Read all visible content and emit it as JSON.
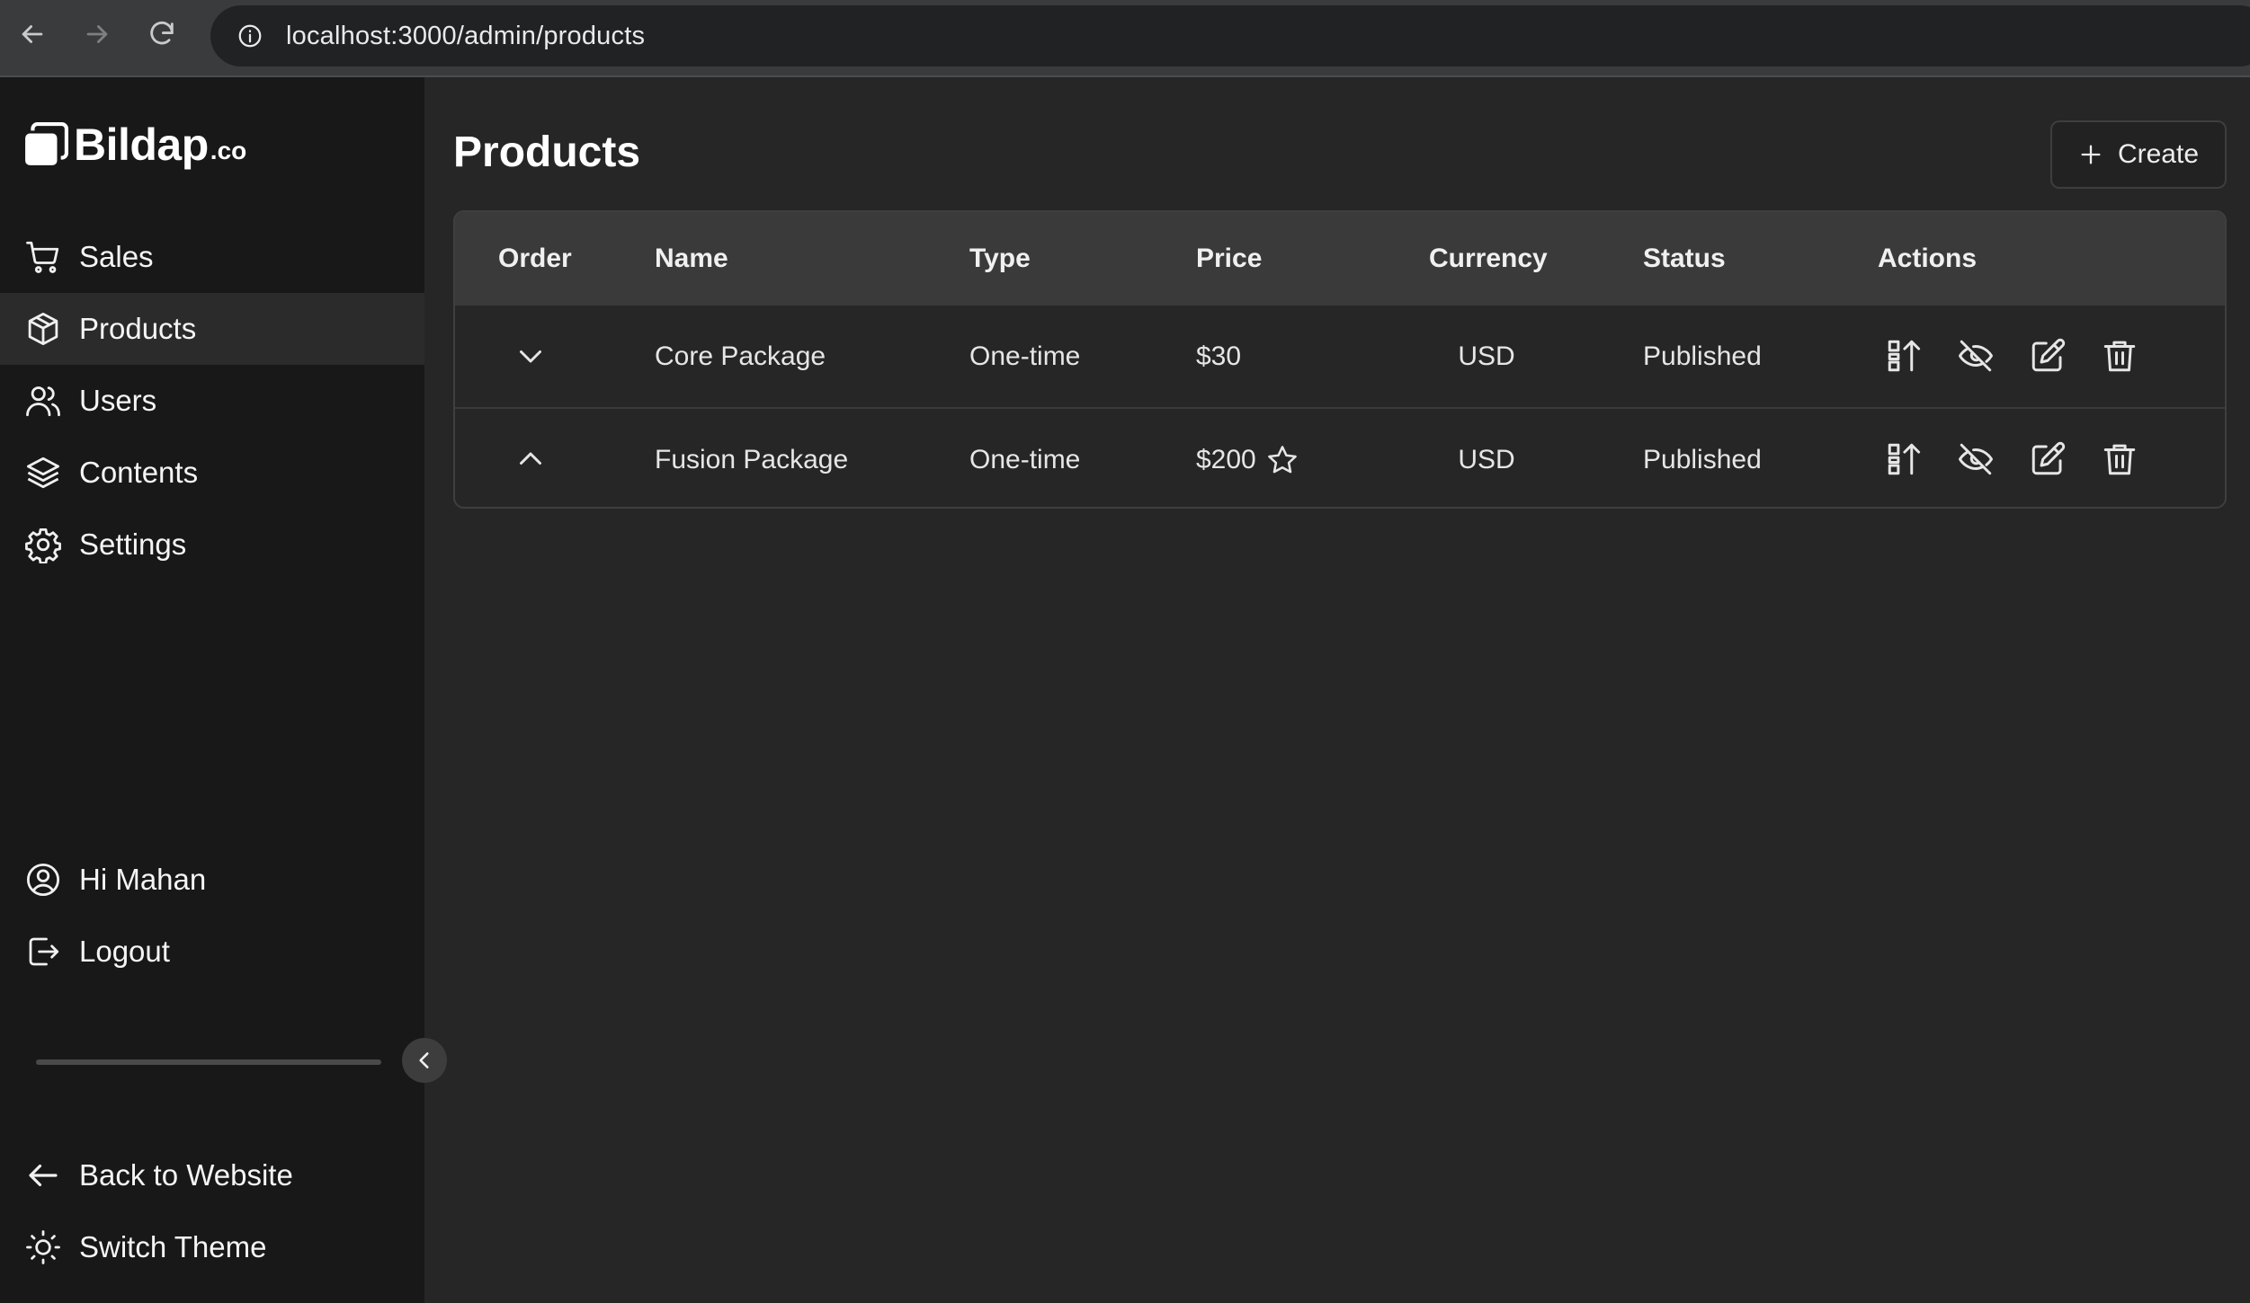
{
  "browser": {
    "url": "localhost:3000/admin/products"
  },
  "sidebar": {
    "brand": "Bildap",
    "brand_tld": ".co",
    "items": [
      {
        "label": "Sales",
        "icon": "cart-icon"
      },
      {
        "label": "Products",
        "icon": "box-icon",
        "active": true
      },
      {
        "label": "Users",
        "icon": "users-icon"
      },
      {
        "label": "Contents",
        "icon": "layers-icon"
      },
      {
        "label": "Settings",
        "icon": "gear-icon"
      }
    ],
    "account": {
      "greeting": "Hi Mahan",
      "logout": "Logout"
    },
    "footer": {
      "back": "Back to Website",
      "theme": "Switch Theme"
    }
  },
  "main": {
    "title": "Products",
    "create_label": "Create",
    "table": {
      "headers": [
        "Order",
        "Name",
        "Type",
        "Price",
        "Currency",
        "Status",
        "Actions"
      ],
      "rows": [
        {
          "name": "Core Package",
          "type": "One-time",
          "price": "$30",
          "featured": false,
          "currency": "USD",
          "status": "Published",
          "order_control": "move-down"
        },
        {
          "name": "Fusion Package",
          "type": "One-time",
          "price": "$200",
          "featured": true,
          "currency": "USD",
          "status": "Published",
          "order_control": "move-up"
        }
      ]
    }
  },
  "colors": {
    "sidebar_bg": "#181818",
    "main_bg": "#262626",
    "header_bg": "#3a3a3a",
    "active_item_bg": "#2b2b2b"
  }
}
